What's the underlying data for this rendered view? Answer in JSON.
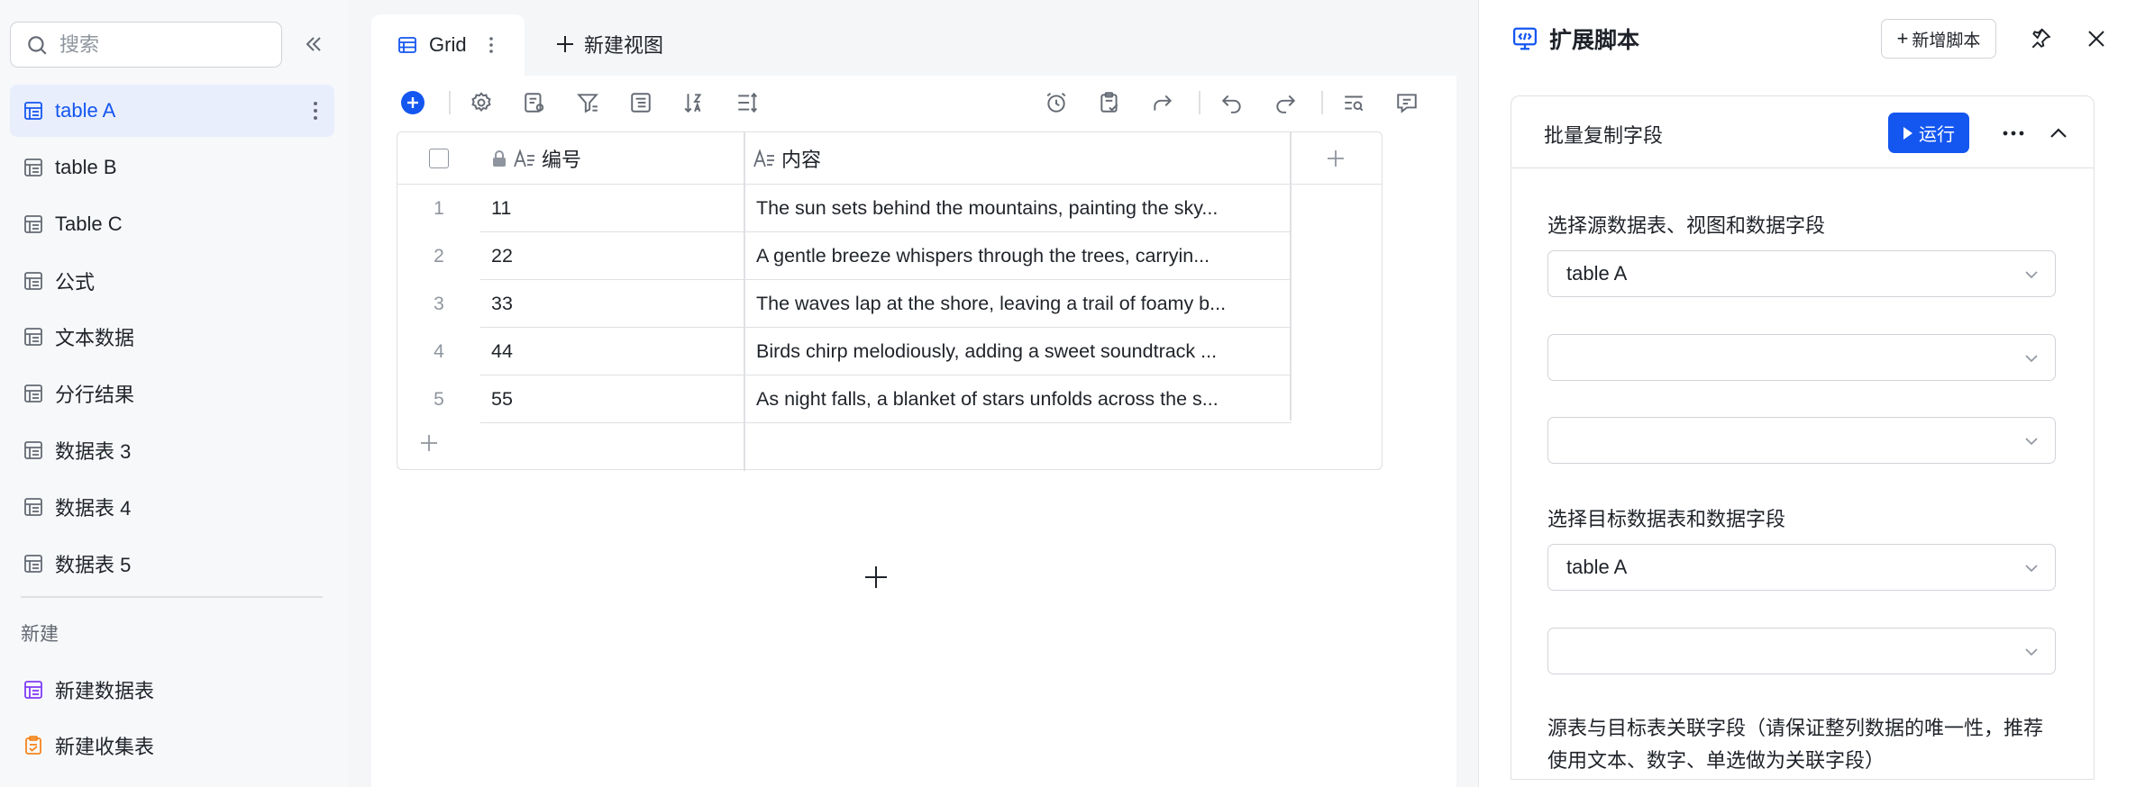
{
  "sidebar": {
    "search_placeholder": "搜索",
    "items": [
      {
        "label": "table A",
        "active": true
      },
      {
        "label": "table B"
      },
      {
        "label": "Table C"
      },
      {
        "label": "公式"
      },
      {
        "label": "文本数据"
      },
      {
        "label": "分行结果"
      },
      {
        "label": "数据表 3"
      },
      {
        "label": "数据表 4"
      },
      {
        "label": "数据表 5"
      }
    ],
    "section_new": "新建",
    "new_items": [
      {
        "label": "新建数据表",
        "icon": "new-table-icon",
        "color": "#7f3bf5"
      },
      {
        "label": "新建收集表",
        "icon": "new-form-icon",
        "color": "#f5851c"
      }
    ]
  },
  "view_tabs": {
    "active": "Grid",
    "new_view": "新建视图"
  },
  "grid": {
    "columns": [
      {
        "label": "编号",
        "locked": true
      },
      {
        "label": "内容",
        "locked": false
      }
    ],
    "rows": [
      {
        "index": "1",
        "id": "11",
        "content": "The sun sets behind the mountains, painting the sky..."
      },
      {
        "index": "2",
        "id": "22",
        "content": "A gentle breeze whispers through the trees, carryin..."
      },
      {
        "index": "3",
        "id": "33",
        "content": "The waves lap at the shore, leaving a trail of foamy b..."
      },
      {
        "index": "4",
        "id": "44",
        "content": "Birds chirp melodiously, adding a sweet soundtrack ..."
      },
      {
        "index": "5",
        "id": "55",
        "content": "As night falls, a blanket of stars unfolds across the s..."
      }
    ]
  },
  "panel": {
    "title": "扩展脚本",
    "add_script": "新增脚本",
    "script": {
      "name": "批量复制字段",
      "run_label": "运行",
      "source_label": "选择源数据表、视图和数据字段",
      "source_table": "table A",
      "source_view": "",
      "source_field": "",
      "target_label": "选择目标数据表和数据字段",
      "target_table": "table A",
      "target_field": "",
      "link_label": "源表与目标表关联字段（请保证整列数据的唯一性，推荐使用文本、数字、单选做为关联字段）"
    }
  },
  "colors": {
    "accent": "#1456f0",
    "active_bg": "#e9eefd",
    "border": "#dee0e3",
    "add_icon": "#1456f0"
  }
}
